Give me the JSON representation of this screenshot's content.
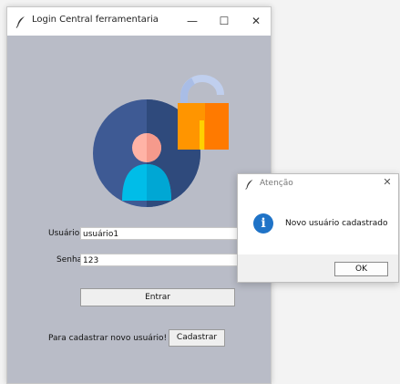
{
  "main_window": {
    "title": "Login Central ferramentaria",
    "controls": {
      "minimize": "—",
      "maximize": "☐",
      "close": "✕"
    },
    "background_color": "#b9bcc7",
    "form": {
      "username_label": "Usuário",
      "username_value": "usuário1",
      "password_label": "Senha",
      "password_value": "123",
      "login_button": "Entrar",
      "register_hint": "Para cadastrar novo usuário!",
      "register_button": "Cadastrar"
    },
    "avatar": {
      "icon": "user-avatar-with-padlock",
      "circle_color": "#3e5a94",
      "lock_color": "#ff8a00"
    }
  },
  "dialog": {
    "title": "Atenção",
    "close": "✕",
    "icon": "info-icon",
    "icon_glyph": "i",
    "icon_color": "#1f73c7",
    "message": "Novo usuário cadastrado",
    "ok_button": "OK"
  }
}
